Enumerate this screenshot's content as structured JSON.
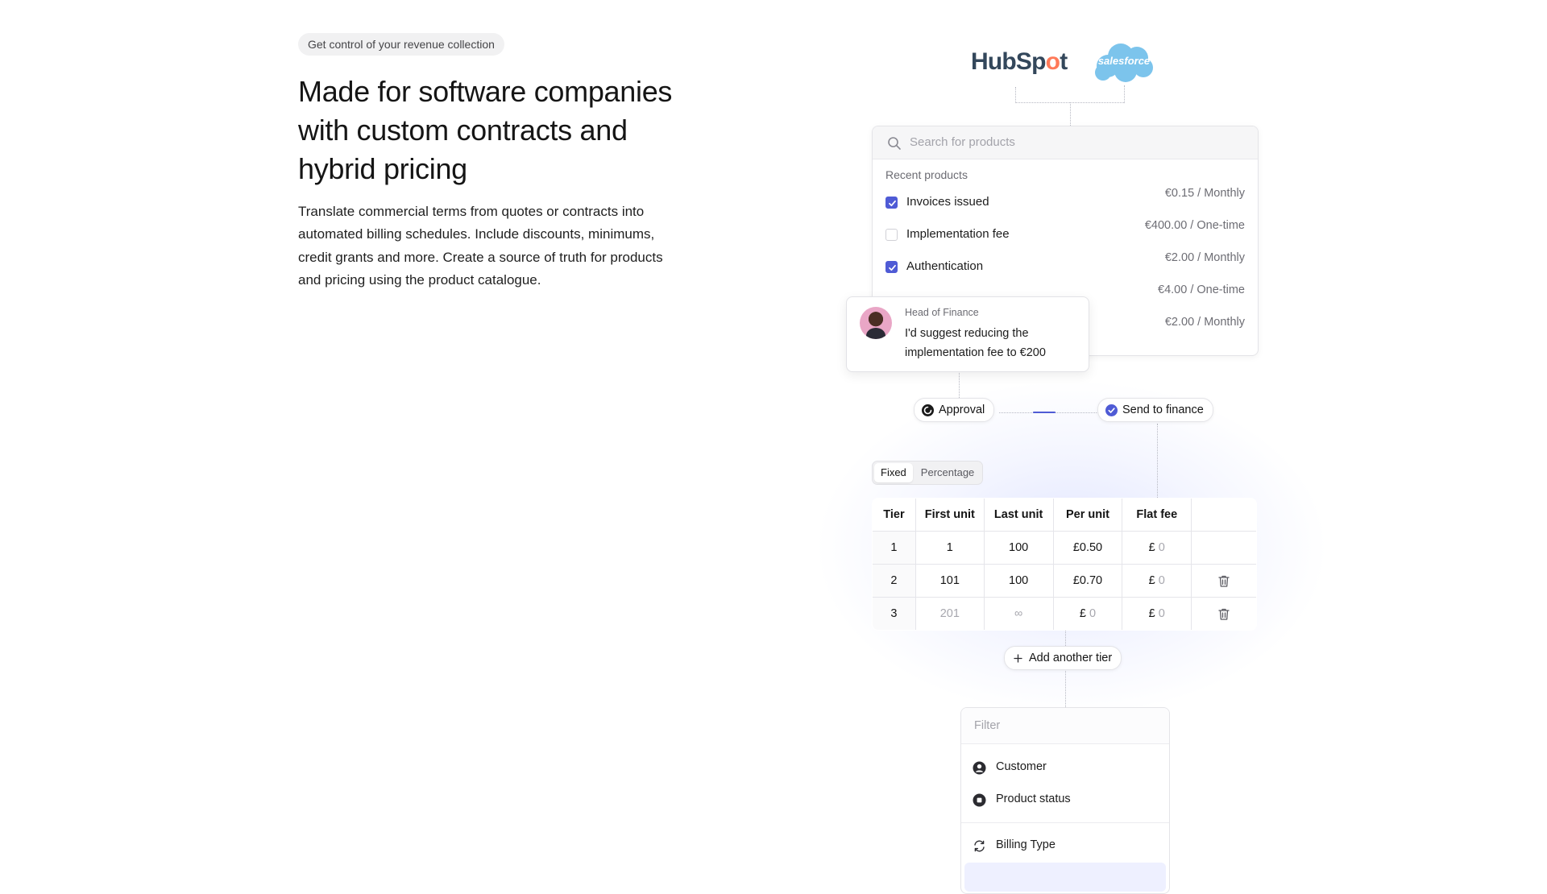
{
  "hero": {
    "pill": "Get control of your revenue collection",
    "headline": "Made for software companies with custom contracts and hybrid pricing",
    "paragraph": "Translate commercial terms from quotes or contracts into automated billing schedules. Include discounts, minimums, credit grants and more. Create a source of truth for products and pricing using the product catalogue."
  },
  "integrations": {
    "hubspot_pre": "HubSp",
    "hubspot_o": "o",
    "hubspot_post": "t",
    "salesforce": "salesforce"
  },
  "products": {
    "search_placeholder": "Search for products",
    "recent_label": "Recent products",
    "items": [
      {
        "name": "Invoices issued",
        "price": "€0.15 / Monthly",
        "checked": true
      },
      {
        "name": "Implementation fee",
        "price": "€400.00 / One-time",
        "checked": false
      },
      {
        "name": "Authentication",
        "price": "€2.00 / Monthly",
        "checked": true
      },
      {
        "name": "",
        "price": "€4.00 / One-time",
        "checked": false
      },
      {
        "name": "",
        "price": "€2.00 / Monthly",
        "checked": false
      }
    ]
  },
  "comment": {
    "role": "Head of Finance",
    "text": "I'd suggest reducing the implementation fee to €200"
  },
  "workflow": {
    "approval": "Approval",
    "send_to_finance": "Send to finance"
  },
  "pricing_toggle": {
    "fixed": "Fixed",
    "percentage": "Percentage",
    "selected": "Fixed"
  },
  "tiers": {
    "headers": [
      "Tier",
      "First unit",
      "Last unit",
      "Per unit",
      "Flat fee"
    ],
    "currency": "£",
    "rows": [
      {
        "tier": "1",
        "first": "1",
        "last": "100",
        "per_unit": "£0.50",
        "flat": "0"
      },
      {
        "tier": "2",
        "first": "101",
        "last": "100",
        "per_unit": "£0.70",
        "flat": "0"
      },
      {
        "tier": "3",
        "first": "201",
        "last": "∞",
        "per_unit": "0",
        "flat": "0"
      }
    ],
    "add_label": "Add another tier"
  },
  "filter": {
    "placeholder": "Filter",
    "items": [
      "Customer",
      "Product status",
      "Billing Type"
    ]
  },
  "colors": {
    "accent": "#4f5bd5",
    "hubspot_orange": "#ff7a59",
    "salesforce_blue": "#7cc4ec"
  }
}
